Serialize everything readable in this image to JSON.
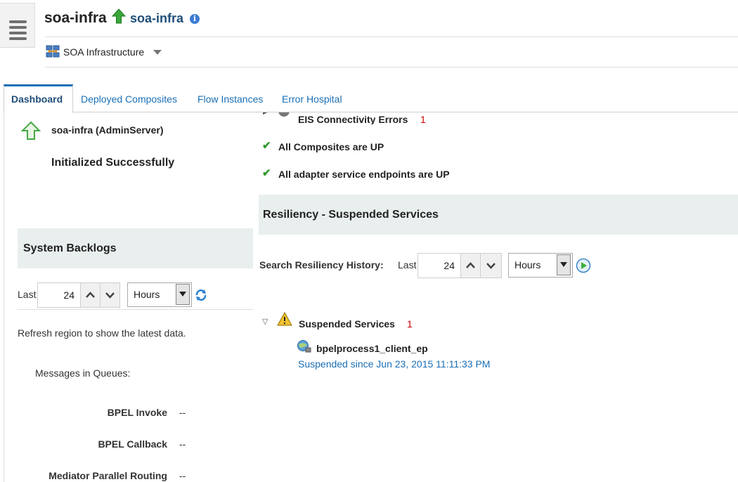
{
  "header": {
    "title": "soa-infra",
    "title_link": "soa-infra",
    "info_glyph": "i",
    "breadcrumb_label": "SOA Infrastructure"
  },
  "tabs": [
    {
      "label": "Dashboard",
      "active": true
    },
    {
      "label": "Deployed Composites",
      "active": false
    },
    {
      "label": "Flow Instances",
      "active": false
    },
    {
      "label": "Error Hospital",
      "active": false
    }
  ],
  "server": {
    "name": "soa-infra (AdminServer)",
    "status": "Initialized Successfully"
  },
  "backlogs": {
    "title": "System Backlogs",
    "last_label": "Last",
    "value": "24",
    "unit": "Hours",
    "refresh_note": "Refresh region to show the latest data.",
    "queues_label": "Messages in Queues:",
    "rows": [
      {
        "label": "BPEL Invoke",
        "value": "--"
      },
      {
        "label": "BPEL Callback",
        "value": "--"
      },
      {
        "label": "Mediator Parallel Routing",
        "value": "--"
      }
    ]
  },
  "status_list": {
    "cut_off_label": "EIS Connectivity Errors",
    "cut_off_count": "1",
    "items": [
      "All Composites are UP",
      "All adapter service endpoints are UP"
    ]
  },
  "resiliency": {
    "title": "Resiliency - Suspended Services",
    "search_label": "Search Resiliency History:",
    "last_label": "Last",
    "value": "24",
    "unit": "Hours",
    "suspended_label": "Suspended Services",
    "suspended_count": "1",
    "service_name": "bpelprocess1_client_ep",
    "suspended_since": "Suspended since Jun 23, 2015 11:11:33 PM"
  },
  "colors": {
    "accent": "#1a6fb5",
    "section_bg": "#e9efee",
    "ok_green": "#2f9a2f",
    "count_red": "#cc0000"
  }
}
